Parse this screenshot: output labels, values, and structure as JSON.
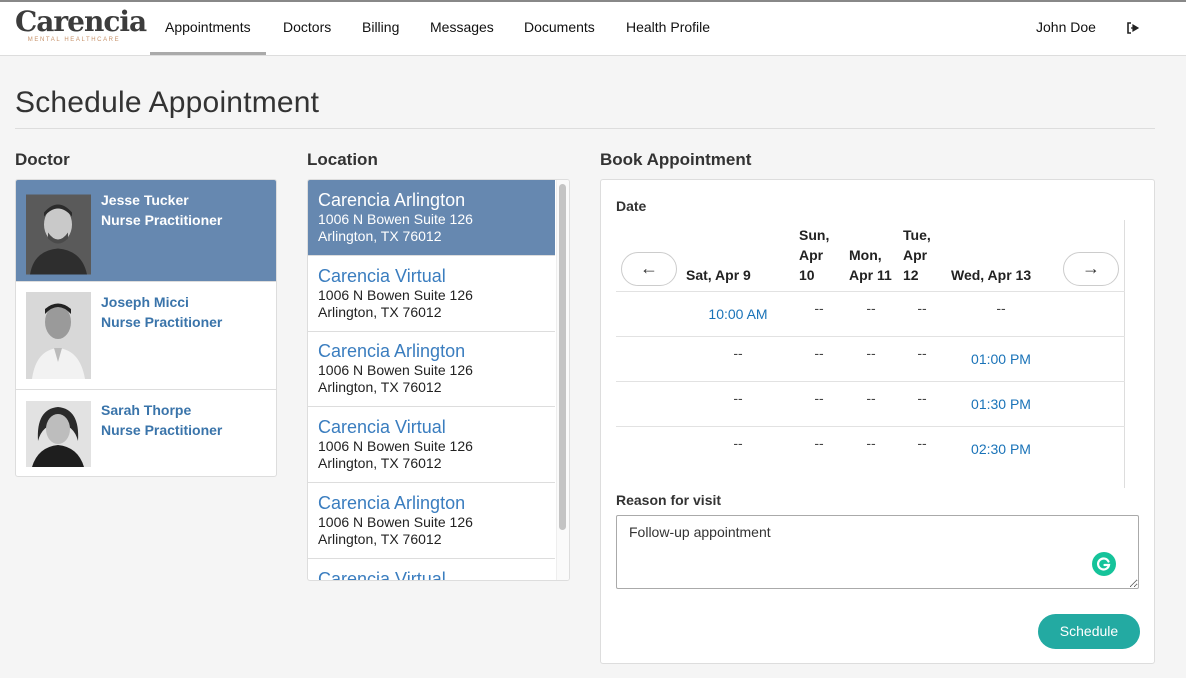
{
  "brand": {
    "name": "Carencia",
    "tagline": "MENTAL HEALTHCARE"
  },
  "nav": {
    "items": [
      {
        "label": "Appointments",
        "active": true
      },
      {
        "label": "Doctors",
        "active": false
      },
      {
        "label": "Billing",
        "active": false
      },
      {
        "label": "Messages",
        "active": false
      },
      {
        "label": "Documents",
        "active": false
      },
      {
        "label": "Health Profile",
        "active": false
      }
    ],
    "user": "John Doe",
    "logout_icon": "logout-icon"
  },
  "page": {
    "title": "Schedule Appointment"
  },
  "doctors": {
    "heading": "Doctor",
    "items": [
      {
        "name": "Jesse Tucker",
        "role": "Nurse Practitioner",
        "selected": true
      },
      {
        "name": "Joseph Micci",
        "role": "Nurse Practitioner",
        "selected": false
      },
      {
        "name": "Sarah Thorpe",
        "role": "Nurse Practitioner",
        "selected": false
      }
    ]
  },
  "locations": {
    "heading": "Location",
    "items": [
      {
        "name": "Carencia Arlington",
        "addr1": "1006 N Bowen Suite 126",
        "addr2": "Arlington, TX 76012",
        "selected": true
      },
      {
        "name": "Carencia Virtual",
        "addr1": "1006 N Bowen Suite 126",
        "addr2": "Arlington, TX 76012",
        "selected": false
      },
      {
        "name": "Carencia Arlington",
        "addr1": "1006 N Bowen Suite 126",
        "addr2": "Arlington, TX 76012",
        "selected": false
      },
      {
        "name": "Carencia Virtual",
        "addr1": "1006 N Bowen Suite 126",
        "addr2": "Arlington, TX 76012",
        "selected": false
      },
      {
        "name": "Carencia Arlington",
        "addr1": "1006 N Bowen Suite 126",
        "addr2": "Arlington, TX 76012",
        "selected": false
      },
      {
        "name": "Carencia Virtual",
        "addr1": "",
        "addr2": "",
        "selected": false
      }
    ]
  },
  "booking": {
    "heading": "Book Appointment",
    "date_label": "Date",
    "prev_label": "←",
    "next_label": "→",
    "days": [
      {
        "lines": [
          "Sat, Apr 9"
        ]
      },
      {
        "lines": [
          "Sun,",
          "Apr",
          "10"
        ]
      },
      {
        "lines": [
          "Mon,",
          "Apr 11"
        ]
      },
      {
        "lines": [
          "Tue,",
          "Apr",
          "12"
        ]
      },
      {
        "lines": [
          "Wed, Apr 13"
        ]
      }
    ],
    "rows": [
      [
        "10:00 AM",
        "--",
        "--",
        "--",
        "--"
      ],
      [
        "--",
        "--",
        "--",
        "--",
        "01:00 PM"
      ],
      [
        "--",
        "--",
        "--",
        "--",
        "01:30 PM"
      ],
      [
        "--",
        "--",
        "--",
        "--",
        "02:30 PM"
      ]
    ],
    "reason_label": "Reason for visit",
    "reason_value": "Follow-up appointment",
    "schedule_label": "Schedule"
  },
  "colors": {
    "accent": "#23aaa2",
    "selected": "#6688b0",
    "link": "#3a74aa"
  }
}
